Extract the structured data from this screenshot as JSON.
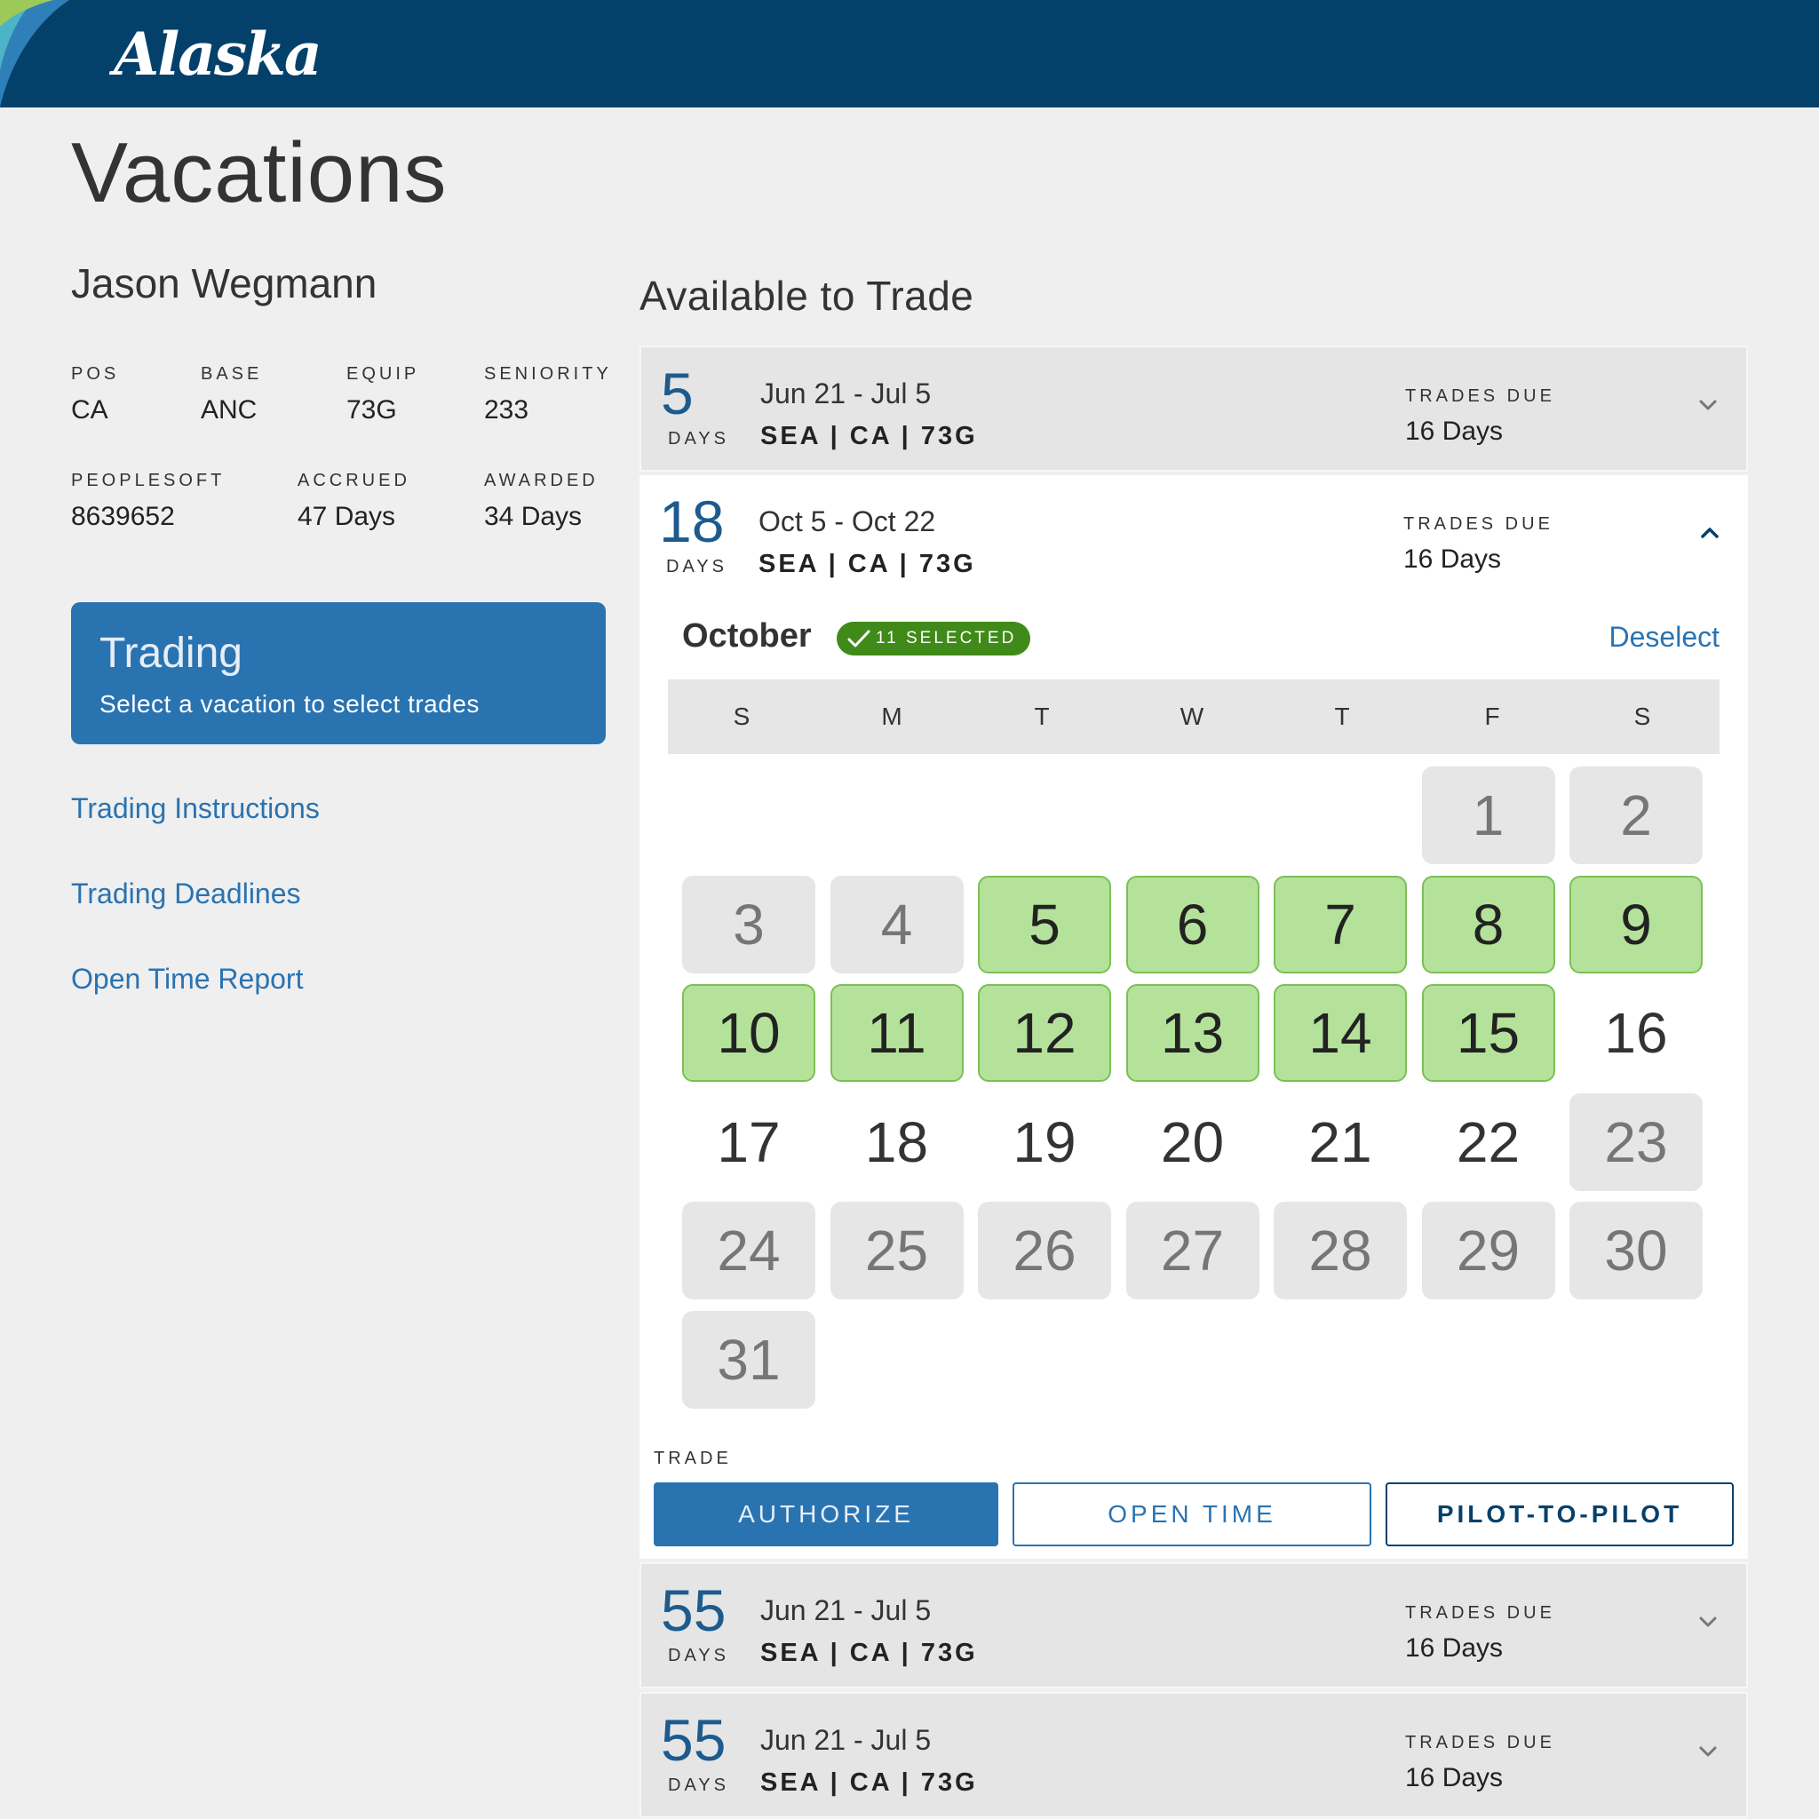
{
  "header": {
    "logo": "Alaska"
  },
  "page": {
    "title": "Vacations"
  },
  "pilot": {
    "name": "Jason Wegmann",
    "stats": [
      {
        "label": "POS",
        "value": "CA"
      },
      {
        "label": "BASE",
        "value": "ANC"
      },
      {
        "label": "EQUIP",
        "value": "73G"
      },
      {
        "label": "SENIORITY",
        "value": "233"
      },
      {
        "label": "PEOPLESOFT",
        "value": "8639652"
      },
      {
        "label": "ACCRUED",
        "value": "47 Days"
      },
      {
        "label": "AWARDED",
        "value": "34 Days"
      }
    ]
  },
  "trading_card": {
    "title": "Trading",
    "subtitle": "Select a vacation to select trades"
  },
  "side_links": [
    "Trading Instructions",
    "Trading Deadlines",
    "Open Time Report"
  ],
  "available": {
    "title": "Available to Trade",
    "vacations": [
      {
        "days": "5",
        "days_label": "DAYS",
        "dates": "Jun 21 - Jul 5",
        "route": "SEA | CA | 73G",
        "due_label": "TRADES DUE",
        "due_value": "16 Days",
        "expanded": false
      },
      {
        "days": "18",
        "days_label": "DAYS",
        "dates": "Oct 5 - Oct 22",
        "route": "SEA | CA | 73G",
        "due_label": "TRADES DUE",
        "due_value": "16 Days",
        "expanded": true
      },
      {
        "days": "55",
        "days_label": "DAYS",
        "dates": "Jun 21 - Jul 5",
        "route": "SEA | CA | 73G",
        "due_label": "TRADES DUE",
        "due_value": "16 Days",
        "expanded": false
      },
      {
        "days": "55",
        "days_label": "DAYS",
        "dates": "Jun 21 - Jul 5",
        "route": "SEA | CA | 73G",
        "due_label": "TRADES DUE",
        "due_value": "16 Days",
        "expanded": false
      }
    ]
  },
  "calendar": {
    "month": "October",
    "selected_badge": "11 SELECTED",
    "deselect_label": "Deselect",
    "weekdays": [
      "S",
      "M",
      "T",
      "W",
      "T",
      "F",
      "S"
    ],
    "first_weekday_index": 5,
    "days": [
      {
        "d": "1",
        "state": "gray"
      },
      {
        "d": "2",
        "state": "gray"
      },
      {
        "d": "3",
        "state": "gray"
      },
      {
        "d": "4",
        "state": "gray"
      },
      {
        "d": "5",
        "state": "green"
      },
      {
        "d": "6",
        "state": "green"
      },
      {
        "d": "7",
        "state": "green"
      },
      {
        "d": "8",
        "state": "green"
      },
      {
        "d": "9",
        "state": "green"
      },
      {
        "d": "10",
        "state": "green"
      },
      {
        "d": "11",
        "state": "green"
      },
      {
        "d": "12",
        "state": "green"
      },
      {
        "d": "13",
        "state": "green"
      },
      {
        "d": "14",
        "state": "green"
      },
      {
        "d": "15",
        "state": "green"
      },
      {
        "d": "16",
        "state": "plain"
      },
      {
        "d": "17",
        "state": "plain"
      },
      {
        "d": "18",
        "state": "plain"
      },
      {
        "d": "19",
        "state": "plain"
      },
      {
        "d": "20",
        "state": "plain"
      },
      {
        "d": "21",
        "state": "plain"
      },
      {
        "d": "22",
        "state": "plain"
      },
      {
        "d": "23",
        "state": "gray"
      },
      {
        "d": "24",
        "state": "gray"
      },
      {
        "d": "25",
        "state": "gray"
      },
      {
        "d": "26",
        "state": "gray"
      },
      {
        "d": "27",
        "state": "gray"
      },
      {
        "d": "28",
        "state": "gray"
      },
      {
        "d": "29",
        "state": "gray"
      },
      {
        "d": "30",
        "state": "gray"
      },
      {
        "d": "31",
        "state": "gray"
      }
    ]
  },
  "trade": {
    "label": "TRADE",
    "buttons": [
      "AUTHORIZE",
      "OPEN TIME",
      "PILOT-TO-PILOT"
    ]
  },
  "colors": {
    "navy": "#03416b",
    "blue": "#2a73b1",
    "green_fill": "#b5e29b",
    "badge_green": "#3f8a19"
  }
}
